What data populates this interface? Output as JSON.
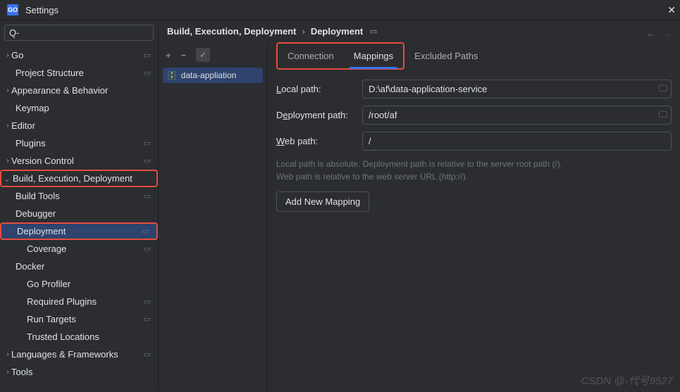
{
  "title": "Settings",
  "logo": "GO",
  "search_placeholder": "",
  "search_prefix": "Q-",
  "sidebar": {
    "items": [
      {
        "label": "Go",
        "chev": "›",
        "pad": "pad0",
        "sep": true
      },
      {
        "label": "Project Structure",
        "chev": "",
        "pad": "pad1",
        "sep": true
      },
      {
        "label": "Appearance & Behavior",
        "chev": "›",
        "pad": "pad0"
      },
      {
        "label": "Keymap",
        "chev": "",
        "pad": "pad1"
      },
      {
        "label": "Editor",
        "chev": "›",
        "pad": "pad0"
      },
      {
        "label": "Plugins",
        "chev": "",
        "pad": "pad1",
        "sep": true
      },
      {
        "label": "Version Control",
        "chev": "›",
        "pad": "pad0",
        "sep": true
      },
      {
        "label": "Build, Execution, Deployment",
        "chev": "v",
        "pad": "pad0",
        "hl": true
      },
      {
        "label": "Build Tools",
        "chev": "›",
        "pad": "pad1",
        "sep": true
      },
      {
        "label": "Debugger",
        "chev": "›",
        "pad": "pad1"
      },
      {
        "label": "Deployment",
        "chev": "›",
        "pad": "pad1",
        "sel": true,
        "sep": true,
        "hl": true
      },
      {
        "label": "Coverage",
        "chev": "",
        "pad": "pad2",
        "sep": true
      },
      {
        "label": "Docker",
        "chev": "›",
        "pad": "pad1"
      },
      {
        "label": "Go Profiler",
        "chev": "",
        "pad": "pad2"
      },
      {
        "label": "Required Plugins",
        "chev": "",
        "pad": "pad2",
        "sep": true
      },
      {
        "label": "Run Targets",
        "chev": "",
        "pad": "pad2",
        "sep": true
      },
      {
        "label": "Trusted Locations",
        "chev": "",
        "pad": "pad2"
      },
      {
        "label": "Languages & Frameworks",
        "chev": "›",
        "pad": "pad0",
        "sep": true
      },
      {
        "label": "Tools",
        "chev": "›",
        "pad": "pad0"
      }
    ]
  },
  "breadcrumb": {
    "a": "Build, Execution, Deployment",
    "sep": "›",
    "b": "Deployment"
  },
  "server_list": {
    "toolbar": {
      "add": "+",
      "remove": "−",
      "check": "✓"
    },
    "items": [
      {
        "label": "data-appliation"
      }
    ]
  },
  "tabs": [
    {
      "label": "Connection",
      "active": false
    },
    {
      "label": "Mappings",
      "active": true
    },
    {
      "label": "Excluded Paths",
      "active": false
    }
  ],
  "form": {
    "local": {
      "label_pre": "L",
      "label_rest": "ocal path:",
      "value": "D:\\af\\data-application-service"
    },
    "deploy": {
      "label_pre": "D",
      "label_mid": "e",
      "label_rest": "ployment path:",
      "value": "/root/af"
    },
    "web": {
      "label_pre": "W",
      "label_rest": "eb path:",
      "value": "/"
    }
  },
  "hint_line1": "Local path is absolute. Deployment path is relative to the server root path (/).",
  "hint_line2": "Web path is relative to the web server URL (http://).",
  "add_mapping": "Add New Mapping",
  "watermark": "CSDN @-代号9527"
}
